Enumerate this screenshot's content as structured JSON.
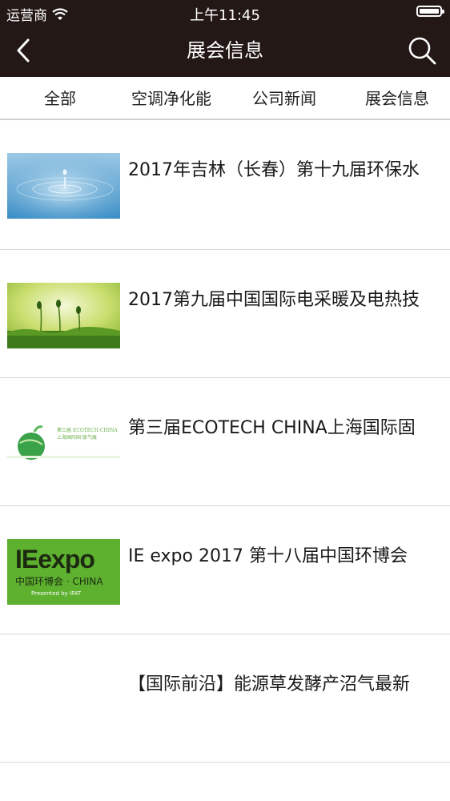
{
  "status_bar": {
    "carrier": "运营商",
    "time": "上午11:45"
  },
  "nav": {
    "title": "展会信息",
    "back_icon": "chevron-left-icon",
    "search_icon": "search-icon"
  },
  "tabs": [
    {
      "label": "全部"
    },
    {
      "label": "空调净化能"
    },
    {
      "label": "公司新闻"
    },
    {
      "label": "展会信息"
    }
  ],
  "articles": [
    {
      "title": "2017年吉林（长春）第十九届环保水",
      "thumb": "water-drop-image"
    },
    {
      "title": "2017第九届中国国际电采暖及电热技",
      "thumb": "green-sprouts-image"
    },
    {
      "title": "第三届ECOTECH CHINA上海国际固",
      "thumb": "ecotech-banner-image",
      "thumb_text": {
        "headline": "第三届 ECOTECH CHINA",
        "sub": "上海国际固·废气展"
      }
    },
    {
      "title": "IE expo 2017 第十八届中国环博会",
      "thumb": "ie-expo-logo",
      "thumb_text": {
        "brand": "IEexpo",
        "cn": "中国环博会 · CHINA",
        "presenter": "Presented by IFAT"
      }
    },
    {
      "title": "【国际前沿】能源草发酵产沼气最新",
      "thumb": ""
    }
  ],
  "colors": {
    "nav_bg": "#231815",
    "ie_green": "#5db12f"
  }
}
